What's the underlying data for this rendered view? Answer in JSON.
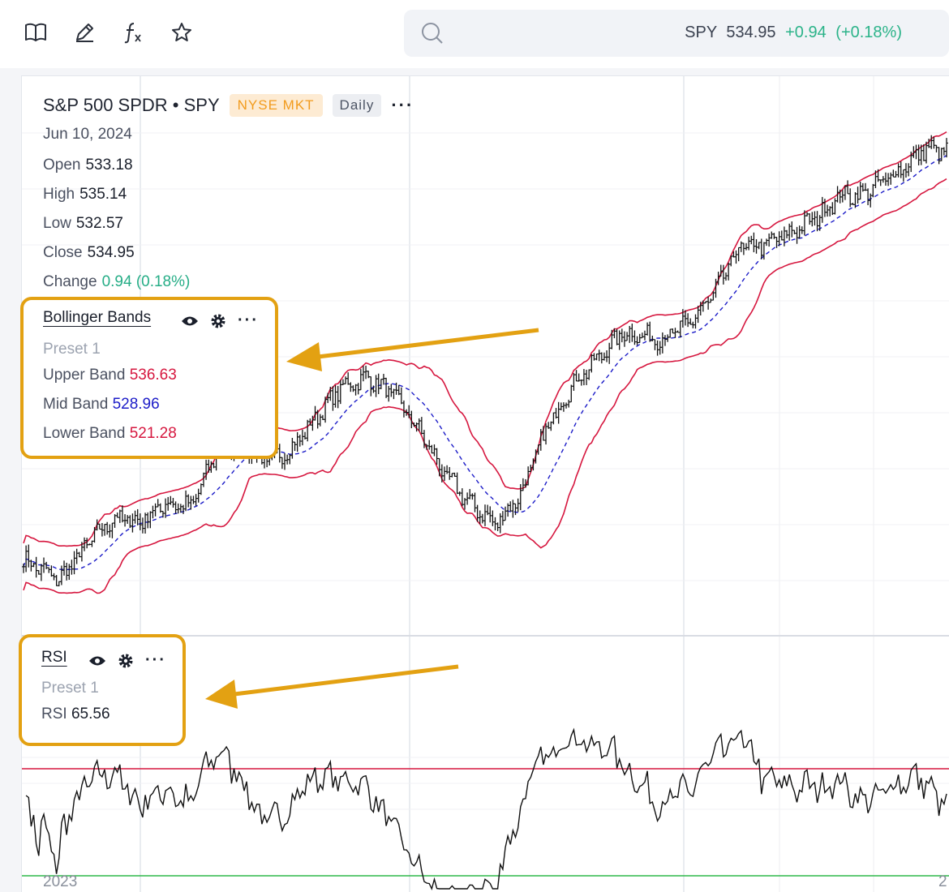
{
  "toolbar": {
    "icons": [
      "book-icon",
      "pencil-icon",
      "function-icon",
      "star-icon"
    ]
  },
  "quote": {
    "symbol": "SPY",
    "price": "534.95",
    "change": "+0.94",
    "change_pct": "(+0.18%)"
  },
  "header": {
    "title": "S&P 500 SPDR • SPY",
    "exchange": "NYSE MKT",
    "interval": "Daily",
    "date": "Jun 10, 2024",
    "open_label": "Open",
    "open": "533.18",
    "high_label": "High",
    "high": "535.14",
    "low_label": "Low",
    "low": "532.57",
    "close_label": "Close",
    "close": "534.95",
    "change_label": "Change",
    "change": "0.94 (0.18%)"
  },
  "bollinger": {
    "title": "Bollinger Bands",
    "preset": "Preset 1",
    "upper_label": "Upper Band",
    "upper": "536.63",
    "mid_label": "Mid Band",
    "mid": "528.96",
    "lower_label": "Lower Band",
    "lower": "521.28"
  },
  "rsi": {
    "title": "RSI",
    "preset": "Preset 1",
    "label": "RSI",
    "value": "65.56"
  },
  "axis": {
    "year_left": "2023",
    "year_right": "2"
  },
  "colors": {
    "accent_box": "#e3a112",
    "band": "#d6173f",
    "mid": "#1c1cc8",
    "up": "#25ad86",
    "rsi_high": "#d6173f",
    "rsi_low": "#2fb84a"
  },
  "chart_data": {
    "type": "line",
    "series": [
      {
        "name": "Bollinger Bands",
        "kind": "ohlc-bars-with-bands",
        "close_start": 395,
        "close_end": 534.95,
        "upper_last": 536.63,
        "mid_last": 528.96,
        "lower_last": 521.28
      },
      {
        "name": "RSI",
        "kind": "oscillator",
        "last": 65.56,
        "overbought": 70,
        "oversold": 30
      }
    ],
    "price_path": [
      [
        0,
        396
      ],
      [
        14,
        389
      ],
      [
        28,
        404
      ],
      [
        36,
        410
      ],
      [
        46,
        409
      ],
      [
        56,
        415
      ],
      [
        66,
        414
      ],
      [
        76,
        432
      ],
      [
        86,
        436
      ],
      [
        96,
        429
      ],
      [
        106,
        434
      ],
      [
        116,
        445
      ],
      [
        126,
        455
      ],
      [
        136,
        458
      ],
      [
        146,
        452
      ],
      [
        156,
        440
      ],
      [
        166,
        425
      ],
      [
        176,
        415
      ],
      [
        186,
        408
      ],
      [
        196,
        418
      ],
      [
        206,
        440
      ],
      [
        216,
        455
      ],
      [
        226,
        464
      ],
      [
        236,
        473
      ],
      [
        244,
        472
      ],
      [
        252,
        471
      ],
      [
        262,
        476
      ],
      [
        272,
        486
      ],
      [
        282,
        502
      ],
      [
        292,
        503
      ],
      [
        302,
        507
      ],
      [
        312,
        512
      ],
      [
        322,
        520
      ],
      [
        330,
        520
      ],
      [
        338,
        524
      ],
      [
        346,
        529
      ],
      [
        356,
        536
      ],
      [
        362,
        535
      ]
    ],
    "x_ticks": [
      "2023",
      "2"
    ]
  }
}
